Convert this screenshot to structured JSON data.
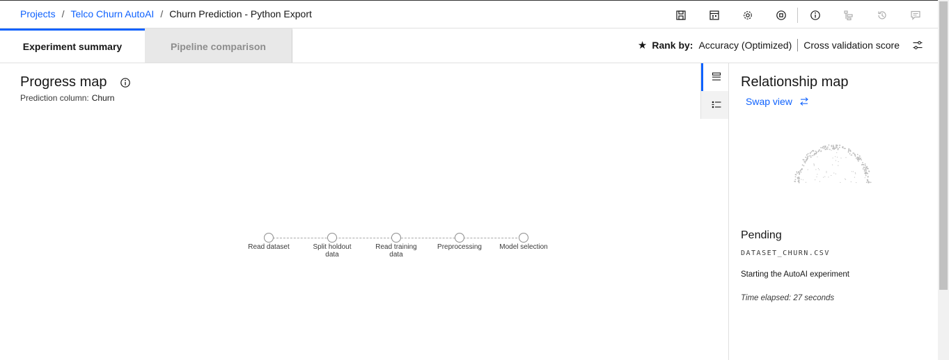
{
  "breadcrumb": {
    "items": [
      "Projects",
      "Telco Churn AutoAI"
    ],
    "separator": "/",
    "current": "Churn Prediction - Python Export"
  },
  "toolbar": {
    "icons": [
      "save-icon",
      "notebook-icon",
      "settings-gear-icon",
      "stop-icon",
      "info-icon",
      "pipeline-flow-icon",
      "history-icon",
      "comment-icon",
      "hierarchy-icon"
    ]
  },
  "tabs": [
    {
      "label": "Experiment summary",
      "active": true
    },
    {
      "label": "Pipeline comparison",
      "active": false
    }
  ],
  "rank": {
    "label": "Rank by:",
    "metric": "Accuracy (Optimized)",
    "score_type": "Cross validation score"
  },
  "progress_map": {
    "title": "Progress map",
    "prediction_label": "Prediction column:",
    "prediction_value": "Churn",
    "stages": [
      "Read dataset",
      "Split holdout data",
      "Read training data",
      "Preprocessing",
      "Model selection"
    ]
  },
  "relationship_map": {
    "title": "Relationship map",
    "swap_label": "Swap view",
    "status": "Pending",
    "dataset": "DATASET_CHURN.CSV",
    "message": "Starting the AutoAI experiment",
    "elapsed": "Time elapsed: 27 seconds"
  },
  "colors": {
    "accent": "#0f62fe",
    "text": "#161616",
    "muted": "#8d8d8d"
  }
}
